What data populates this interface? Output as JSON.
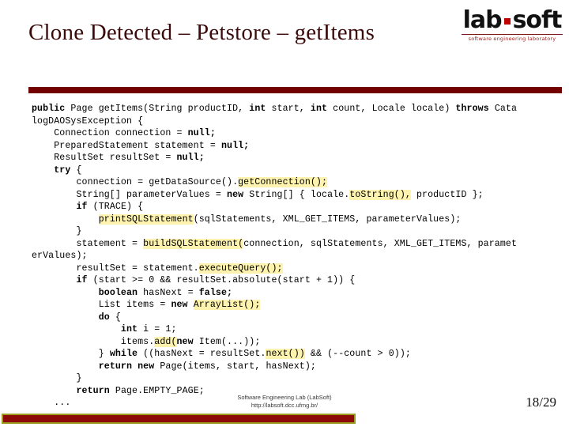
{
  "slide": {
    "title": "Clone Detected – Petstore – getItems",
    "page_number": "18/29",
    "accent_dark_red": "#730000",
    "accent_title_color": "#3b0b0b",
    "highlight_color": "#fdf3ae",
    "bottom_bar_fill": "#8c0b08",
    "bottom_bar_border": "#9a9d22"
  },
  "logo": {
    "word_left": "lab",
    "word_right": "soft",
    "separator": "square-dot",
    "tagline": "software engineering laboratory"
  },
  "footer": {
    "line1": "Software Engineering Lab (LabSoft)",
    "line2": "http://labsoft.dcc.ufmg.br/"
  },
  "code": {
    "language": "java",
    "lines": [
      [
        {
          "t": "public",
          "b": true
        },
        {
          "t": " Page getItems(String productID, "
        },
        {
          "t": "int",
          "b": true
        },
        {
          "t": " start, "
        },
        {
          "t": "int",
          "b": true
        },
        {
          "t": " count, Locale locale) "
        },
        {
          "t": "throws",
          "b": true
        },
        {
          "t": " Cata"
        }
      ],
      [
        {
          "t": "logDAOSysException {"
        }
      ],
      [
        {
          "t": "    Connection connection = "
        },
        {
          "t": "null;",
          "b": true
        }
      ],
      [
        {
          "t": "    PreparedStatement statement = "
        },
        {
          "t": "null;",
          "b": true
        }
      ],
      [
        {
          "t": "    ResultSet resultSet = "
        },
        {
          "t": "null;",
          "b": true
        }
      ],
      [
        {
          "t": "    "
        },
        {
          "t": "try",
          "b": true
        },
        {
          "t": " {"
        }
      ],
      [
        {
          "t": "        connection = getDataSource()."
        },
        {
          "t": "getConnection();",
          "h": true
        }
      ],
      [
        {
          "t": "        String[] parameterValues = "
        },
        {
          "t": "new",
          "b": true
        },
        {
          "t": " String[] { locale."
        },
        {
          "t": "toString(),",
          "h": true
        },
        {
          "t": " productID };"
        }
      ],
      [
        {
          "t": "        "
        },
        {
          "t": "if",
          "b": true
        },
        {
          "t": " (TRACE) {"
        }
      ],
      [
        {
          "t": "            "
        },
        {
          "t": "printSQLStatement",
          "h": true
        },
        {
          "t": "(sqlStatements, XML_GET_ITEMS, parameterValues);"
        }
      ],
      [
        {
          "t": "        }"
        }
      ],
      [
        {
          "t": "        statement = "
        },
        {
          "t": "buildSQLStatement(",
          "h": true
        },
        {
          "t": "connection, sqlStatements, XML_GET_ITEMS, paramet"
        }
      ],
      [
        {
          "t": "erValues);"
        }
      ],
      [
        {
          "t": "        resultSet = statement."
        },
        {
          "t": "executeQuery();",
          "h": true
        }
      ],
      [
        {
          "t": "        "
        },
        {
          "t": "if",
          "b": true
        },
        {
          "t": " (start >= 0 && resultSet.absolute(start + 1)) {"
        }
      ],
      [
        {
          "t": "            "
        },
        {
          "t": "boolean",
          "b": true
        },
        {
          "t": " hasNext = "
        },
        {
          "t": "false;",
          "b": true
        }
      ],
      [
        {
          "t": "            List items = "
        },
        {
          "t": "new",
          "b": true
        },
        {
          "t": " "
        },
        {
          "t": "ArrayList();",
          "h": true
        }
      ],
      [
        {
          "t": "            "
        },
        {
          "t": "do",
          "b": true
        },
        {
          "t": " {"
        }
      ],
      [
        {
          "t": "                "
        },
        {
          "t": "int",
          "b": true
        },
        {
          "t": " i = 1;"
        }
      ],
      [
        {
          "t": "                items."
        },
        {
          "t": "add(",
          "h": true
        },
        {
          "t": "new",
          "b": true
        },
        {
          "t": " Item(...));"
        }
      ],
      [
        {
          "t": "            } "
        },
        {
          "t": "while",
          "b": true
        },
        {
          "t": " ((hasNext = resultSet."
        },
        {
          "t": "next())",
          "h": true
        },
        {
          "t": " && (--count > 0));"
        }
      ],
      [
        {
          "t": "            "
        },
        {
          "t": "return",
          "b": true
        },
        {
          "t": " "
        },
        {
          "t": "new",
          "b": true
        },
        {
          "t": " Page(items, start, hasNext);"
        }
      ],
      [
        {
          "t": "        }"
        }
      ],
      [
        {
          "t": "        "
        },
        {
          "t": "return",
          "b": true
        },
        {
          "t": " Page.EMPTY_PAGE;"
        }
      ],
      [
        {
          "t": "    ..."
        }
      ]
    ]
  }
}
